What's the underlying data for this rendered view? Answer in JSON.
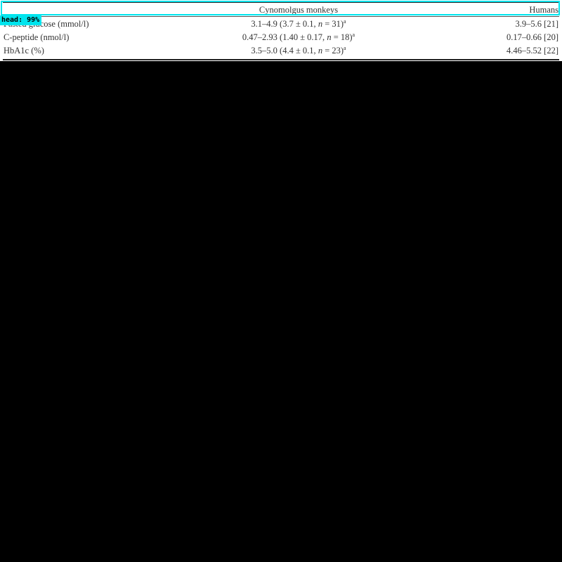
{
  "table": {
    "header": {
      "col_label": "",
      "col_monkey": "Cynomolgus monkeys",
      "col_human": "Humans"
    },
    "rows": [
      {
        "label": "Fasted glucose (mmol/l)",
        "monkey": "3.1–4.9 (3.7 ± 0.1, ",
        "monkey_n": "n",
        "monkey_tail": " = 31)",
        "monkey_sup": "a",
        "human": "3.9–5.6 [21]"
      },
      {
        "label": "C-peptide (nmol/l)",
        "monkey": "0.47–2.93 (1.40 ± 0.17, ",
        "monkey_n": "n",
        "monkey_tail": " = 18)",
        "monkey_sup": "a",
        "human": "0.17–0.66 [20]"
      },
      {
        "label": "HbA1c (%)",
        "monkey": "3.5–5.0 (4.4 ± 0.1, ",
        "monkey_n": "n",
        "monkey_tail": " = 23)",
        "monkey_sup": "a",
        "human": "4.46–5.52 [22]"
      }
    ]
  },
  "detection": {
    "label": "head: 99%",
    "color": "#00e5ee"
  },
  "colors": {
    "background": "#000000",
    "table_background": "#ffffff",
    "text": "#333333"
  }
}
